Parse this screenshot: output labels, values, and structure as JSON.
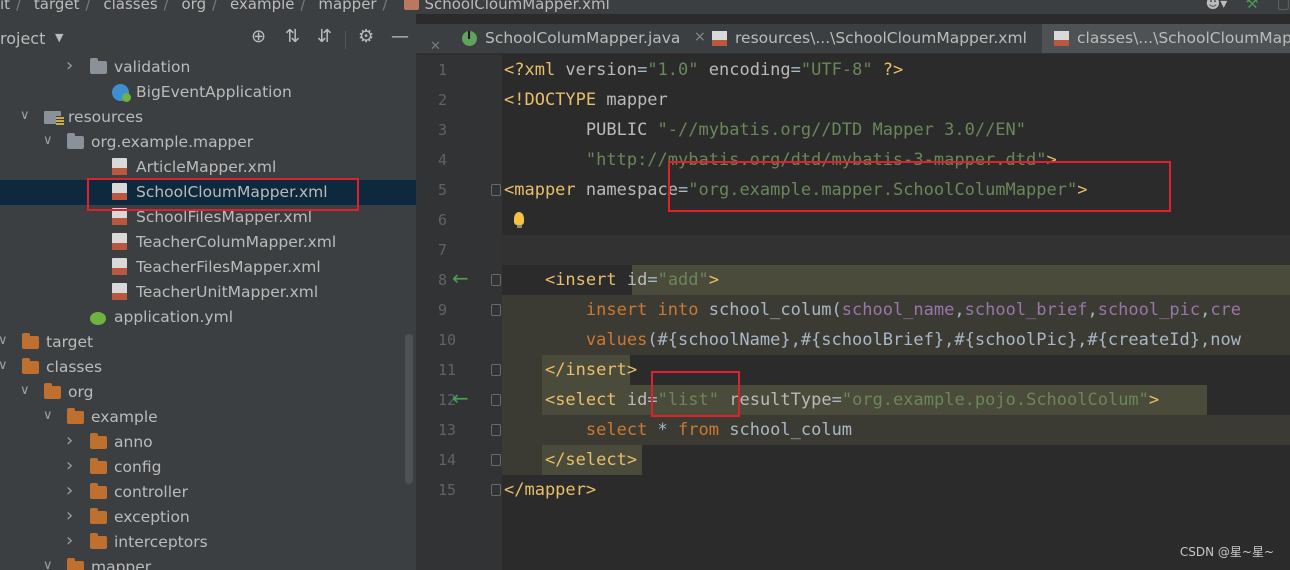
{
  "breadcrumb": {
    "items": [
      "it",
      "target",
      "classes",
      "org",
      "example",
      "mapper"
    ],
    "file": "SchoolCloumMapper.xml"
  },
  "project_panel": {
    "title": "roject",
    "tree": [
      {
        "label": "validation",
        "icon": "folder-gray-icon",
        "arrow": "collapsed"
      },
      {
        "label": "BigEventApplication",
        "icon": "spring-app-icon",
        "arrow": "none"
      },
      {
        "label": "resources",
        "icon": "resources-folder-icon",
        "arrow": "expanded"
      },
      {
        "label": "org.example.mapper",
        "icon": "folder-gray-icon",
        "arrow": "expanded"
      },
      {
        "label": "ArticleMapper.xml",
        "icon": "xml-file-icon",
        "arrow": "none"
      },
      {
        "label": "SchoolCloumMapper.xml",
        "icon": "xml-file-icon",
        "arrow": "none",
        "selected": true
      },
      {
        "label": "SchoolFilesMapper.xml",
        "icon": "xml-file-icon",
        "arrow": "none"
      },
      {
        "label": "TeacherColumMapper.xml",
        "icon": "xml-file-icon",
        "arrow": "none"
      },
      {
        "label": "TeacherFilesMapper.xml",
        "icon": "xml-file-icon",
        "arrow": "none"
      },
      {
        "label": "TeacherUnitMapper.xml",
        "icon": "xml-file-icon",
        "arrow": "none"
      },
      {
        "label": "application.yml",
        "icon": "yml-file-icon",
        "arrow": "none"
      },
      {
        "label": "target",
        "icon": "folder-orange-icon",
        "arrow": "expanded"
      },
      {
        "label": "classes",
        "icon": "folder-orange-icon",
        "arrow": "expanded"
      },
      {
        "label": "org",
        "icon": "folder-orange-icon",
        "arrow": "expanded"
      },
      {
        "label": "example",
        "icon": "folder-orange-icon",
        "arrow": "expanded"
      },
      {
        "label": "anno",
        "icon": "folder-orange-icon",
        "arrow": "collapsed"
      },
      {
        "label": "config",
        "icon": "folder-orange-icon",
        "arrow": "collapsed"
      },
      {
        "label": "controller",
        "icon": "folder-orange-icon",
        "arrow": "collapsed"
      },
      {
        "label": "exception",
        "icon": "folder-orange-icon",
        "arrow": "collapsed"
      },
      {
        "label": "interceptors",
        "icon": "folder-orange-icon",
        "arrow": "collapsed"
      },
      {
        "label": "mapper",
        "icon": "folder-orange-icon",
        "arrow": "expanded"
      }
    ]
  },
  "tabs": [
    {
      "label": "SchoolColumMapper.java",
      "icon": "java-class-icon",
      "active": false
    },
    {
      "label": "resources\\...\\SchoolCloumMapper.xml",
      "icon": "xml-file-icon",
      "active": false
    },
    {
      "label": "classes\\...\\SchoolCloumMapp",
      "icon": "xml-file-icon",
      "active": true
    }
  ],
  "code_lines": [
    {
      "num": "1",
      "tokens": [
        [
          "t-tag",
          "<?xml "
        ],
        [
          "t-attr",
          "version"
        ],
        [
          "t-plain",
          "="
        ],
        [
          "t-str",
          "\"1.0\""
        ],
        [
          "t-plain",
          " "
        ],
        [
          "t-attr",
          "encoding"
        ],
        [
          "t-plain",
          "="
        ],
        [
          "t-str",
          "\"UTF-8\""
        ],
        [
          "t-tag",
          " ?>"
        ]
      ]
    },
    {
      "num": "2",
      "tokens": [
        [
          "t-tag",
          "<!DOCTYPE "
        ],
        [
          "t-attr",
          "mapper"
        ]
      ]
    },
    {
      "num": "3",
      "tokens": [
        [
          "t-plain",
          "        "
        ],
        [
          "t-attr",
          "PUBLIC "
        ],
        [
          "t-str",
          "\"-//mybatis.org//DTD Mapper 3.0//EN\""
        ]
      ]
    },
    {
      "num": "4",
      "tokens": [
        [
          "t-plain",
          "        "
        ],
        [
          "t-str",
          "\"http://mybatis.org/dtd/mybatis-3-mapper.dtd\""
        ],
        [
          "t-tag",
          ">"
        ]
      ]
    },
    {
      "num": "5",
      "tokens": [
        [
          "t-tag",
          "<mapper "
        ],
        [
          "t-attr",
          "namespace"
        ],
        [
          "t-plain",
          "="
        ],
        [
          "t-str",
          "\"org.example.mapper.SchoolColumMapper\""
        ],
        [
          "t-tag",
          ">"
        ]
      ]
    },
    {
      "num": "6",
      "tokens": []
    },
    {
      "num": "7",
      "tokens": []
    },
    {
      "num": "8",
      "tokens": [
        [
          "t-plain",
          "    "
        ],
        [
          "t-tag",
          "<insert "
        ],
        [
          "t-attr",
          "id"
        ],
        [
          "t-plain",
          "="
        ],
        [
          "t-str",
          "\"add\""
        ],
        [
          "t-tag",
          ">"
        ]
      ]
    },
    {
      "num": "9",
      "tokens": [
        [
          "t-plain",
          "        "
        ],
        [
          "t-kw",
          "insert into "
        ],
        [
          "t-txt",
          "school_colum("
        ],
        [
          "t-col",
          "school_name"
        ],
        [
          "t-txt",
          ","
        ],
        [
          "t-col",
          "school_brief"
        ],
        [
          "t-txt",
          ","
        ],
        [
          "t-col",
          "school_pic"
        ],
        [
          "t-txt",
          ","
        ],
        [
          "t-col",
          "cre"
        ]
      ]
    },
    {
      "num": "10",
      "tokens": [
        [
          "t-plain",
          "        "
        ],
        [
          "t-kw",
          "values"
        ],
        [
          "t-txt",
          "(#{schoolName},#{schoolBrief},#{schoolPic},#{createId},now"
        ]
      ]
    },
    {
      "num": "11",
      "tokens": [
        [
          "t-plain",
          "    "
        ],
        [
          "t-tag",
          "</insert>"
        ]
      ]
    },
    {
      "num": "12",
      "tokens": [
        [
          "t-plain",
          "    "
        ],
        [
          "t-tag",
          "<select "
        ],
        [
          "t-attr",
          "id"
        ],
        [
          "t-plain",
          "="
        ],
        [
          "t-str",
          "\"list\""
        ],
        [
          "t-plain",
          " "
        ],
        [
          "t-attr",
          "resultType"
        ],
        [
          "t-plain",
          "="
        ],
        [
          "t-str",
          "\"org.example.pojo.SchoolColum\""
        ],
        [
          "t-tag",
          ">"
        ]
      ]
    },
    {
      "num": "13",
      "tokens": [
        [
          "t-plain",
          "        "
        ],
        [
          "t-kw",
          "select "
        ],
        [
          "t-txt",
          "* "
        ],
        [
          "t-kw",
          "from "
        ],
        [
          "t-txt",
          "school_colum"
        ]
      ]
    },
    {
      "num": "14",
      "tokens": [
        [
          "t-plain",
          "    "
        ],
        [
          "t-tag",
          "</select>"
        ]
      ]
    },
    {
      "num": "15",
      "tokens": [
        [
          "t-tag",
          "</mapper>"
        ]
      ]
    }
  ],
  "watermark": "CSDN @星~星~",
  "colors": {
    "accent_red": "#e0202c",
    "selection": "#0d293e",
    "tag": "#e8bf6a",
    "string": "#6a8759"
  }
}
